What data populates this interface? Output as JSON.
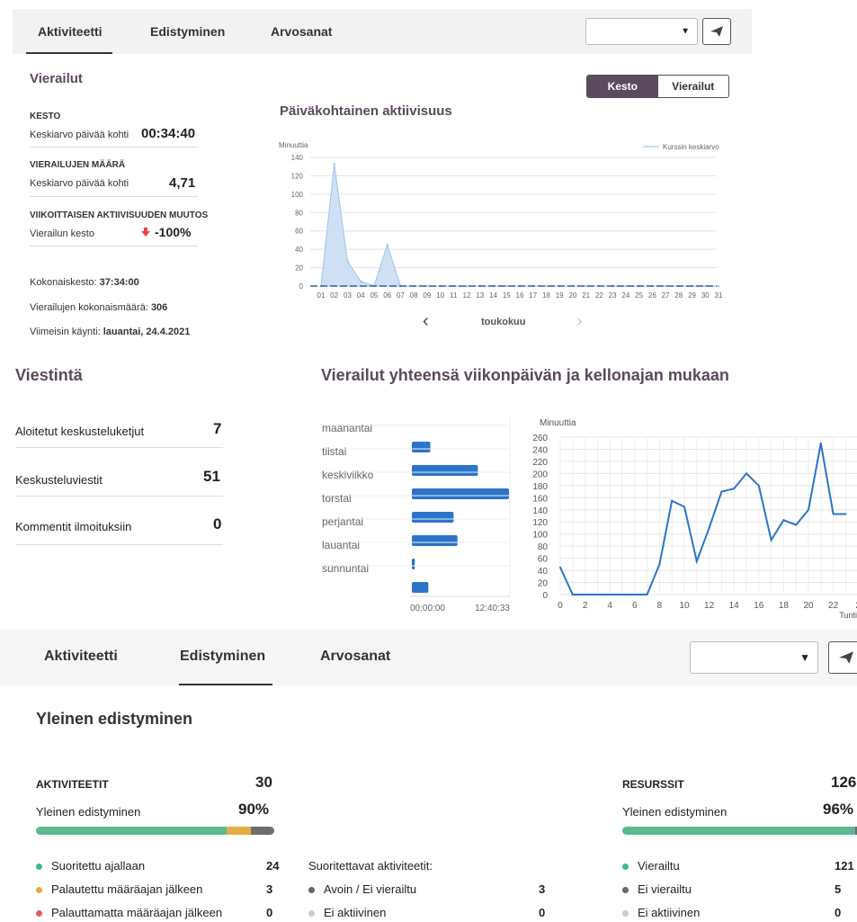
{
  "top_tabs": {
    "tabs": [
      {
        "label": "Aktiviteetti"
      },
      {
        "label": "Edistyminen"
      },
      {
        "label": "Arvosanat"
      }
    ],
    "active": 0,
    "select_value": ""
  },
  "visits": {
    "title": "Vierailut",
    "duration_label": "KESTO",
    "duration_sub": "Keskiarvo päivää kohti",
    "duration_value": "00:34:40",
    "count_label": "VIERAILUJEN MÄÄRÄ",
    "count_sub": "Keskiarvo päivää kohti",
    "count_value": "4,71",
    "change_label": "VIIKOITTAISEN AKTIIVISUUDEN MUUTOS",
    "change_sub": "Vierailun kesto",
    "change_value": "-100%",
    "total_duration_label": "Kokonaiskesto:",
    "total_duration_value": "37:34:00",
    "total_visits_label": "Vierailujen kokonaismäärä:",
    "total_visits_value": "306",
    "last_visit_label": "Viimeisin käynti:",
    "last_visit_value": "lauantai, 24.4.2021"
  },
  "toggle": {
    "kesto": "Kesto",
    "vierailut": "Vierailut"
  },
  "daily_chart": {
    "title": "Päiväkohtainen aktiivisuus",
    "ylabel": "Minuuttia",
    "legend": "Kurssin keskiarvo",
    "month": "toukokuu",
    "prev": "‹",
    "next": "›"
  },
  "messaging": {
    "title": "Viestintä",
    "rows": [
      {
        "label": "Aloitetut keskusteluketjut",
        "value": "7"
      },
      {
        "label": "Keskusteluviestit",
        "value": "51"
      },
      {
        "label": "Kommentit ilmoituksiin",
        "value": "0"
      }
    ]
  },
  "weekday_title": "Vierailut yhteensä viikonpäivän ja kellonajan mukaan",
  "weekday_chart": {
    "type": "bar",
    "categories": [
      "maanantai",
      "tiistai",
      "keskiviikko",
      "torstai",
      "perjantai",
      "lauantai",
      "sunnuntai"
    ],
    "values": [
      0.19,
      0.68,
      1.0,
      0.43,
      0.47,
      0.03,
      0.17
    ],
    "xticks": [
      "00:00:00",
      "12:40:33"
    ]
  },
  "hourly_chart": {
    "type": "line",
    "ylabel": "Minuuttia",
    "xlabel": "Tunti",
    "x": [
      0,
      1,
      2,
      3,
      4,
      5,
      6,
      7,
      8,
      9,
      10,
      11,
      12,
      13,
      14,
      15,
      16,
      17,
      18,
      19,
      20,
      21,
      22,
      23
    ],
    "values": [
      45,
      0,
      0,
      0,
      0,
      0,
      0,
      0,
      50,
      155,
      145,
      55,
      110,
      170,
      175,
      200,
      180,
      90,
      123,
      115,
      140,
      250,
      133,
      133
    ],
    "ylim": [
      0,
      260
    ],
    "yticks": [
      "0",
      "20",
      "40",
      "60",
      "80",
      "100",
      "120",
      "140",
      "160",
      "180",
      "200",
      "220",
      "240",
      "260"
    ],
    "xticks": [
      "0",
      "2",
      "4",
      "6",
      "8",
      "10",
      "12",
      "14",
      "16",
      "18",
      "20",
      "22",
      "2"
    ]
  },
  "daily_chart_data": {
    "chart_data": null
  },
  "chart_data": [
    {
      "type": "area",
      "title": "Päiväkohtainen aktiivisuus",
      "ylabel": "Minuuttia",
      "categories": [
        "01",
        "02",
        "03",
        "04",
        "05",
        "06",
        "07",
        "08",
        "09",
        "10",
        "11",
        "12",
        "13",
        "14",
        "15",
        "16",
        "17",
        "18",
        "19",
        "20",
        "21",
        "22",
        "23",
        "24",
        "25",
        "26",
        "27",
        "28",
        "29",
        "30",
        "31"
      ],
      "series": [
        {
          "name": "Kurssin keskiarvo",
          "values": [
            0,
            133,
            27,
            5,
            0,
            45,
            0,
            0,
            0,
            0,
            0,
            0,
            0,
            0,
            0,
            0,
            0,
            0,
            0,
            0,
            0,
            0,
            0,
            0,
            0,
            0,
            0,
            0,
            0,
            0,
            0
          ]
        }
      ],
      "ylim": [
        0,
        140
      ],
      "yticks": [
        "0",
        "20",
        "40",
        "60",
        "80",
        "100",
        "120",
        "140"
      ]
    },
    {
      "type": "bar",
      "categories": [
        "maanantai",
        "tiistai",
        "keskiviikko",
        "torstai",
        "perjantai",
        "lauantai",
        "sunnuntai"
      ],
      "values": [
        0.19,
        0.68,
        1.0,
        0.43,
        0.47,
        0.03,
        0.17
      ]
    },
    {
      "type": "line",
      "ylabel": "Minuuttia",
      "xlabel": "Tunti",
      "x": [
        0,
        1,
        2,
        3,
        4,
        5,
        6,
        7,
        8,
        9,
        10,
        11,
        12,
        13,
        14,
        15,
        16,
        17,
        18,
        19,
        20,
        21,
        22,
        23
      ],
      "values": [
        45,
        0,
        0,
        0,
        0,
        0,
        0,
        0,
        50,
        155,
        145,
        55,
        110,
        170,
        175,
        200,
        180,
        90,
        123,
        115,
        140,
        250,
        133,
        133
      ],
      "ylim": [
        0,
        260
      ]
    }
  ],
  "bottom_tabs": {
    "tabs": [
      {
        "label": "Aktiviteetti"
      },
      {
        "label": "Edistyminen"
      },
      {
        "label": "Arvosanat"
      }
    ],
    "active": 1,
    "select_value": ""
  },
  "progress": {
    "title": "Yleinen edistyminen",
    "activities": {
      "label": "AKTIVITEETIT",
      "count": "30",
      "overall_label": "Yleinen edistyminen",
      "overall_value": "90%",
      "segments": [
        {
          "fraction": 0.8,
          "color": "#5cb88e"
        },
        {
          "fraction": 0.1,
          "color": "#e3ad45"
        },
        {
          "fraction": 0.1,
          "color": "#6d6d6d"
        }
      ],
      "items": [
        {
          "label": "Suoritettu ajallaan",
          "value": "24",
          "color": "#3dba86"
        },
        {
          "label": "Palautettu määräajan jälkeen",
          "value": "3",
          "color": "#e3ad45"
        },
        {
          "label": "Palauttamatta määräajan jälkeen",
          "value": "0",
          "color": "#e65b5b"
        }
      ]
    },
    "todo": {
      "label": "Suoritettavat aktiviteetit:",
      "items": [
        {
          "label": "Avoin / Ei vierailtu",
          "value": "3",
          "color": "#666"
        },
        {
          "label": "Ei aktiivinen",
          "value": "0",
          "color": "#ccc"
        }
      ]
    },
    "resources": {
      "label": "RESURSSIT",
      "count": "126",
      "overall_label": "Yleinen edistyminen",
      "overall_value": "96%",
      "segments": [
        {
          "fraction": 0.96,
          "color": "#5cb88e"
        },
        {
          "fraction": 0.04,
          "color": "#6d6d6d"
        }
      ],
      "items": [
        {
          "label": "Vierailtu",
          "value": "121",
          "color": "#3dba86"
        },
        {
          "label": "Ei vierailtu",
          "value": "5",
          "color": "#666"
        },
        {
          "label": "Ei aktiivinen",
          "value": "0",
          "color": "#ccc"
        }
      ]
    }
  }
}
